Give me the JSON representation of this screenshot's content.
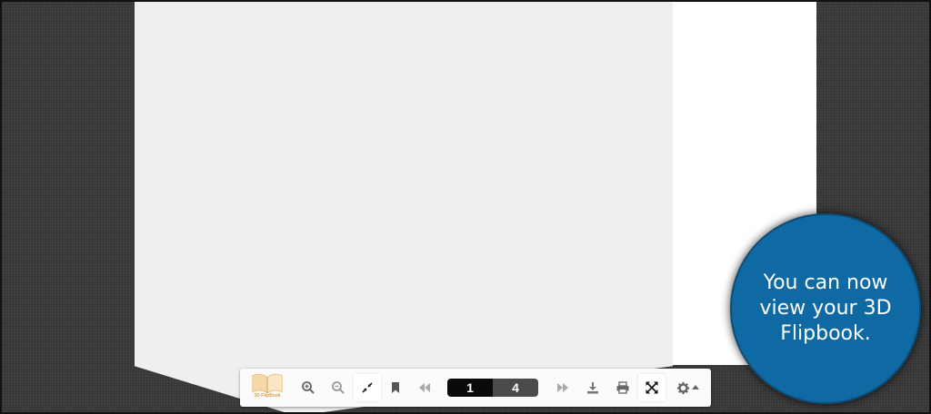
{
  "toolbar": {
    "logo_label": "3D FlipBook",
    "icons": {
      "zoom_in": "zoom-in-icon",
      "zoom_out": "zoom-out-icon",
      "exit_fit": "compress-icon",
      "bookmark": "bookmark-icon",
      "prev": "rewind-icon",
      "next": "fast-forward-icon",
      "download": "download-icon",
      "print": "print-icon",
      "fullscreen": "expand-icon",
      "settings": "gear-icon"
    },
    "current_page": "1",
    "total_pages": "4"
  },
  "callout": {
    "text": "You can now view your 3D Flipbook."
  },
  "colors": {
    "background": "#3b3b3b",
    "left_page": "#efefef",
    "right_page": "#ffffff",
    "callout": "#0f6aa3",
    "icon": "#555555",
    "icon_disabled": "#aaaaaa"
  }
}
